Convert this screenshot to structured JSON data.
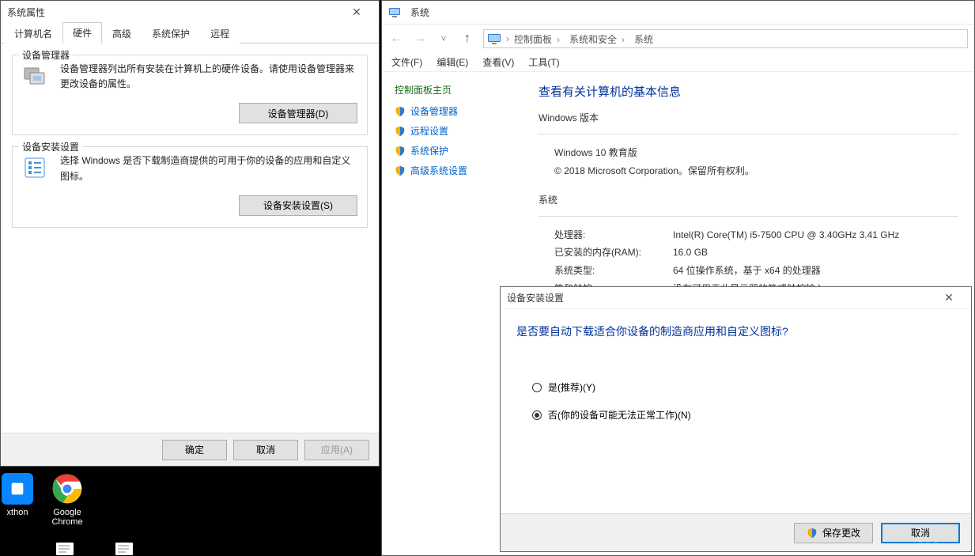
{
  "sysprops": {
    "title": "系统属性",
    "tabs": [
      "计算机名",
      "硬件",
      "高级",
      "系统保护",
      "远程"
    ],
    "active_tab": 1,
    "group_devmgr": {
      "legend": "设备管理器",
      "desc": "设备管理器列出所有安装在计算机上的硬件设备。请使用设备管理器来更改设备的属性。",
      "btn": "设备管理器(D)"
    },
    "group_install": {
      "legend": "设备安装设置",
      "desc": "选择 Windows 是否下载制造商提供的可用于你的设备的应用和自定义图标。",
      "btn": "设备安装设置(S)"
    },
    "buttons": {
      "ok": "确定",
      "cancel": "取消",
      "apply": "应用(A)"
    }
  },
  "systemwin": {
    "title": "系统",
    "crumbs": [
      "控制面板",
      "系统和安全",
      "系统"
    ],
    "menu": [
      "文件(F)",
      "编辑(E)",
      "查看(V)",
      "工具(T)"
    ],
    "side_head": "控制面板主页",
    "side_links": [
      "设备管理器",
      "远程设置",
      "系统保护",
      "高级系统设置"
    ],
    "heading": "查看有关计算机的基本信息",
    "winver_title": "Windows 版本",
    "winver_lines": [
      "Windows 10 教育版",
      "© 2018 Microsoft Corporation。保留所有权利。"
    ],
    "sys_title": "系统",
    "sys_rows": [
      {
        "k": "处理器:",
        "v": "Intel(R) Core(TM) i5-7500 CPU @ 3.40GHz   3.41 GHz"
      },
      {
        "k": "已安装的内存(RAM):",
        "v": "16.0 GB"
      },
      {
        "k": "系统类型:",
        "v": "64 位操作系统，基于 x64 的处理器"
      },
      {
        "k": "笔和触控:",
        "v": "没有可用于此显示器的笔或触控输入"
      }
    ]
  },
  "modal": {
    "title": "设备安装设置",
    "question": "是否要自动下载适合你设备的制造商应用和自定义图标?",
    "opt_yes": "是(推荐)(Y)",
    "opt_no": "否(你的设备可能无法正常工作)(N)",
    "selected": "no",
    "save": "保存更改",
    "cancel": "取消"
  },
  "desktop": {
    "icon1": "xthon",
    "icon2": "Google Chrome"
  },
  "watermark": "ni329.com"
}
